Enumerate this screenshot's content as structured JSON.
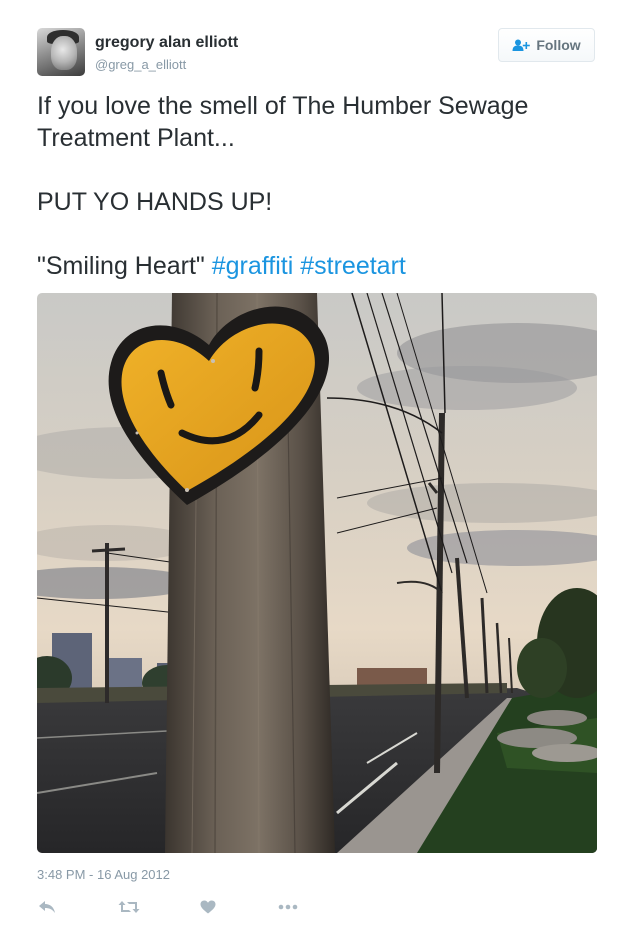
{
  "user": {
    "full_name": "gregory alan elliott",
    "handle": "@greg_a_elliott"
  },
  "follow_button": {
    "label": "Follow"
  },
  "tweet": {
    "line1": "If you love the smell of The Humber Sewage Treatment Plant...",
    "line2": "PUT YO HANDS UP!",
    "line3_text": "\"Smiling Heart\" ",
    "hashtag1": "#graffiti",
    "hashtag2": "#streetart",
    "timestamp": "3:48 PM - 16 Aug 2012"
  },
  "actions": [
    "reply-icon",
    "retweet-icon",
    "like-icon",
    "more-icon"
  ],
  "colors": {
    "link": "#1b95e0",
    "secondary_text": "#8899a6",
    "primary_text": "#292f33"
  }
}
